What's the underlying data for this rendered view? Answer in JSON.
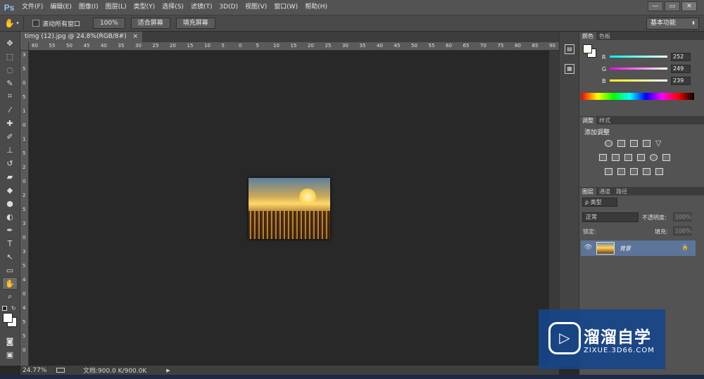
{
  "app": {
    "logo": "Ps"
  },
  "menu": [
    "文件(F)",
    "编辑(E)",
    "图像(I)",
    "图层(L)",
    "类型(Y)",
    "选择(S)",
    "滤镜(T)",
    "3D(D)",
    "视图(V)",
    "窗口(W)",
    "帮助(H)"
  ],
  "window_buttons": {
    "minimize": "—",
    "restore": "▭",
    "close": "✕"
  },
  "options": {
    "tool_icon": "hand-icon",
    "scroll_all_label": "滚动所有窗口",
    "zoom100": "100%",
    "fit_screen": "适合屏幕",
    "fill_screen": "填充屏幕",
    "workspace": "基本功能"
  },
  "document": {
    "tab_title": "timg (12).jpg @ 24.8%(RGB/8#)",
    "tab_close": "×"
  },
  "ruler": {
    "h_ticks": [
      "60",
      "55",
      "50",
      "45",
      "40",
      "35",
      "30",
      "25",
      "20",
      "15",
      "10",
      "5",
      "0",
      "5",
      "10",
      "15",
      "20",
      "25",
      "30",
      "35",
      "40",
      "45",
      "50",
      "55",
      "60",
      "65",
      "70",
      "75",
      "80",
      "85",
      "90"
    ],
    "v_ticks": [
      "3",
      "5",
      "0",
      "5",
      "1",
      "0",
      "1",
      "5",
      "2",
      "0",
      "2",
      "5",
      "3",
      "0",
      "3",
      "5",
      "4",
      "0",
      "4",
      "5",
      "5",
      "0"
    ]
  },
  "status": {
    "zoom": "24.77%",
    "doc_info": "文档:900.0 K/900.0K",
    "arrow": "▶"
  },
  "color_panel": {
    "tabs": [
      "颜色",
      "色板"
    ],
    "r_label": "R",
    "g_label": "G",
    "b_label": "B",
    "r": "252",
    "g": "249",
    "b": "239",
    "fg_color": "#fcf9ef"
  },
  "adjust_panel": {
    "tabs": [
      "调整",
      "样式"
    ],
    "title": "添加调整"
  },
  "layers_panel": {
    "tabs": [
      "图层",
      "通道",
      "路径"
    ],
    "filter_kind": "ρ 类型",
    "blend_mode": "正常",
    "opacity_label": "不透明度:",
    "opacity_value": "100%",
    "lock_label": "锁定:",
    "fill_label": "填充:",
    "fill_value": "100%",
    "layer_name": "背景"
  },
  "watermark": {
    "brand": "溜溜自学",
    "url": "ZIXUE.3D66.COM"
  }
}
